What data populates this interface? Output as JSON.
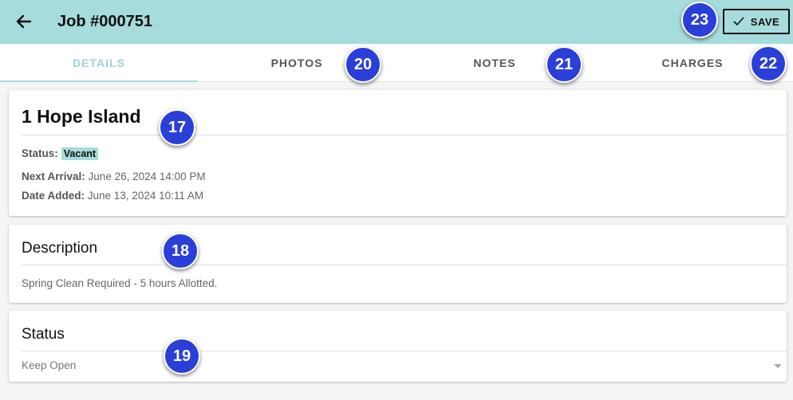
{
  "header": {
    "title": "Job #000751",
    "save_label": "SAVE",
    "background": "#a6dcdb"
  },
  "tabs": [
    {
      "label": "DETAILS",
      "active": true
    },
    {
      "label": "PHOTOS",
      "active": false
    },
    {
      "label": "NOTES",
      "active": false
    },
    {
      "label": "CHARGES",
      "active": false
    }
  ],
  "property": {
    "name": "1 Hope Island",
    "status_label": "Status:",
    "status_value": "Vacant",
    "next_arrival_label": "Next Arrival:",
    "next_arrival_value": "June 26, 2024 14:00 PM",
    "date_added_label": "Date Added:",
    "date_added_value": "June 13, 2024 10:11 AM"
  },
  "description": {
    "heading": "Description",
    "text": "Spring Clean Required - 5 hours Allotted."
  },
  "status_section": {
    "heading": "Status",
    "selected_value": "Keep Open"
  },
  "callouts": {
    "c17": "17",
    "c18": "18",
    "c19": "19",
    "c20": "20",
    "c21": "21",
    "c22": "22",
    "c23": "23"
  },
  "colors": {
    "accent": "#a6dcdb",
    "callout": "#2a3fd8"
  }
}
